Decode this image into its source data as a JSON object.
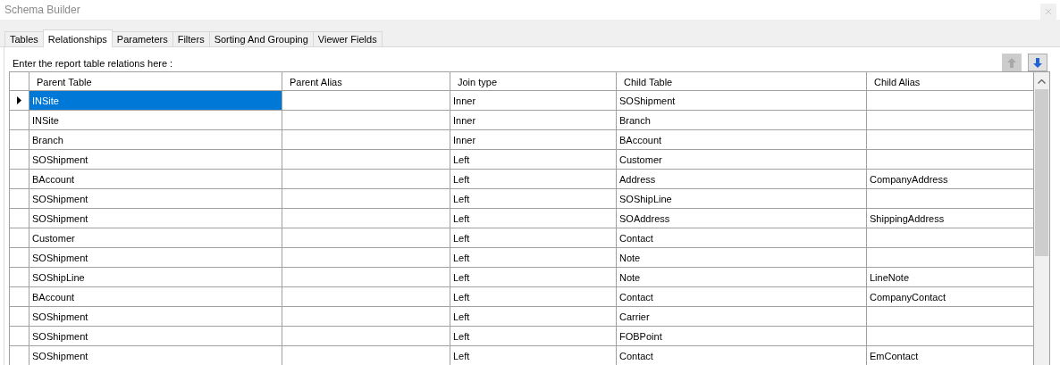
{
  "window": {
    "title": "Schema Builder"
  },
  "tabs": [
    {
      "label": "Tables",
      "selected": false
    },
    {
      "label": "Relationships",
      "selected": true
    },
    {
      "label": "Parameters",
      "selected": false
    },
    {
      "label": "Filters",
      "selected": false
    },
    {
      "label": "Sorting And Grouping",
      "selected": false
    },
    {
      "label": "Viewer Fields",
      "selected": false
    }
  ],
  "instruction": "Enter the report table relations here :",
  "move_buttons": [
    {
      "kind": "up",
      "disabled": true
    },
    {
      "kind": "down",
      "disabled": false
    }
  ],
  "table": {
    "columns": [
      "Parent Table",
      "Parent Alias",
      "Join type",
      "Child Table",
      "Child Alias"
    ],
    "rows": [
      {
        "selected": true,
        "cells": [
          "INSite",
          "",
          "Inner",
          "SOShipment",
          ""
        ]
      },
      {
        "selected": false,
        "cells": [
          "INSite",
          "",
          "Inner",
          "Branch",
          ""
        ]
      },
      {
        "selected": false,
        "cells": [
          "Branch",
          "",
          "Inner",
          "BAccount",
          ""
        ]
      },
      {
        "selected": false,
        "cells": [
          "SOShipment",
          "",
          "Left",
          "Customer",
          ""
        ]
      },
      {
        "selected": false,
        "cells": [
          "BAccount",
          "",
          "Left",
          "Address",
          "CompanyAddress"
        ]
      },
      {
        "selected": false,
        "cells": [
          "SOShipment",
          "",
          "Left",
          "SOShipLine",
          ""
        ]
      },
      {
        "selected": false,
        "cells": [
          "SOShipment",
          "",
          "Left",
          "SOAddress",
          "ShippingAddress"
        ]
      },
      {
        "selected": false,
        "cells": [
          "Customer",
          "",
          "Left",
          "Contact",
          ""
        ]
      },
      {
        "selected": false,
        "cells": [
          "SOShipment",
          "",
          "Left",
          "Note",
          ""
        ]
      },
      {
        "selected": false,
        "cells": [
          "SOShipLine",
          "",
          "Left",
          "Note",
          "LineNote"
        ]
      },
      {
        "selected": false,
        "cells": [
          "BAccount",
          "",
          "Left",
          "Contact",
          "CompanyContact"
        ]
      },
      {
        "selected": false,
        "cells": [
          "SOShipment",
          "",
          "Left",
          "Carrier",
          ""
        ]
      },
      {
        "selected": false,
        "cells": [
          "SOShipment",
          "",
          "Left",
          "FOBPoint",
          ""
        ]
      },
      {
        "selected": false,
        "cells": [
          "SOShipment",
          "",
          "Left",
          "Contact",
          "EmContact"
        ]
      }
    ]
  }
}
